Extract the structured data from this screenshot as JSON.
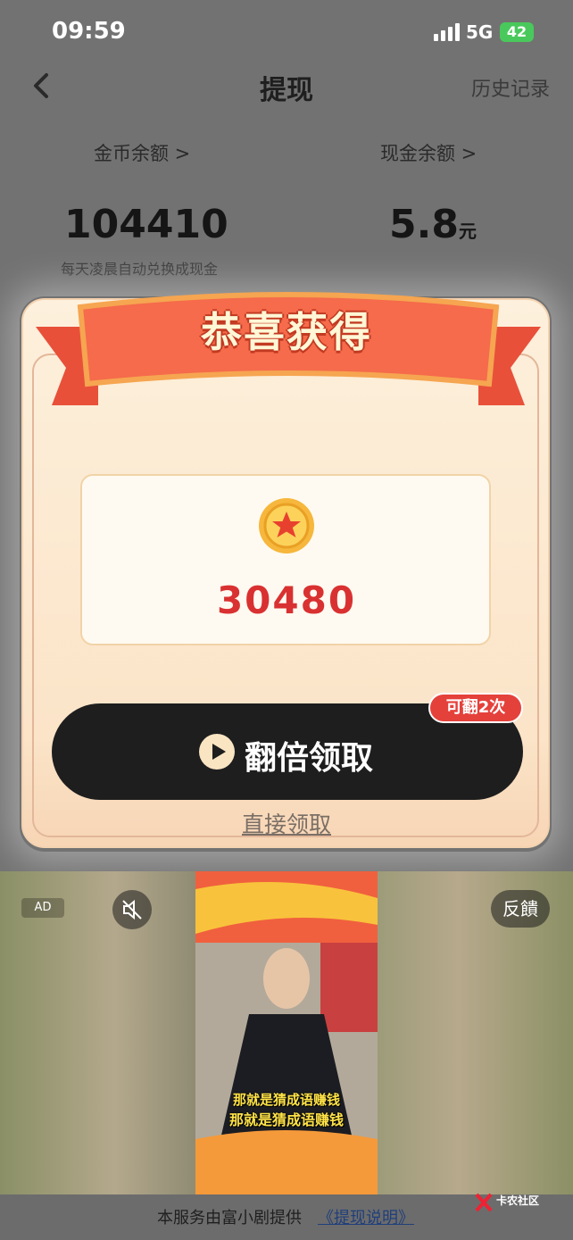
{
  "status_bar": {
    "time": "09:59",
    "network": "5G",
    "battery": "42"
  },
  "header": {
    "title": "提现",
    "history": "历史记录"
  },
  "balance": {
    "coin_label": "金币余额 >",
    "coin_value": "104410",
    "cash_label": "现金余额 >",
    "cash_value": "5.8",
    "cash_unit": "元",
    "note": "每天凌晨自动兑换成现金"
  },
  "modal": {
    "title": "恭喜获得",
    "reward_amount": "30480",
    "double_button": "翻倍领取",
    "badge": "可翻2次",
    "direct_claim": "直接领取"
  },
  "ad": {
    "tag": "AD",
    "feedback": "反饋",
    "caption_top": "那就是猜成语赚钱",
    "caption_bottom": "那就是猜成语赚钱"
  },
  "footer": {
    "text": "本服务由富小剧提供",
    "link": "《提现说明》",
    "watermark": "卡农社区"
  },
  "colors": {
    "accent_red": "#d93131",
    "badge_red": "#e5413b",
    "button_dark": "#1e1e1e"
  }
}
